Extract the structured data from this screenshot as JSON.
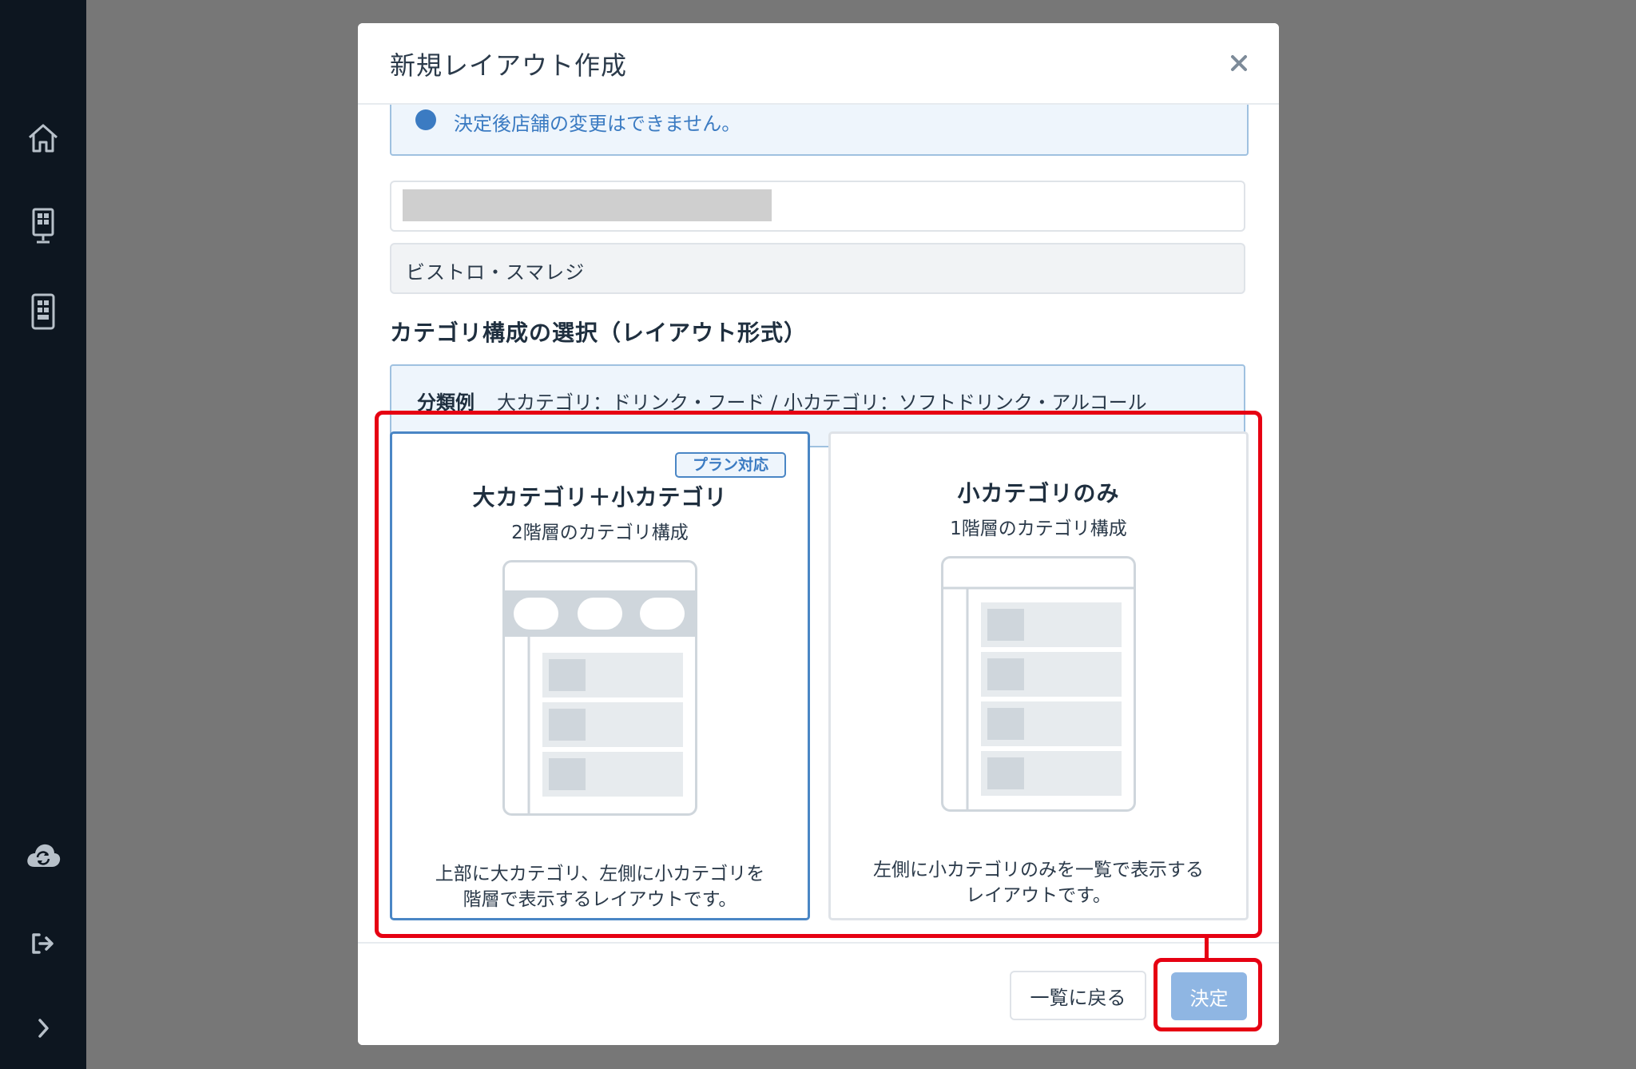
{
  "sidebar": {
    "items": [
      {
        "icon": "home-icon"
      },
      {
        "icon": "register-terminal-icon"
      },
      {
        "icon": "handheld-device-icon"
      },
      {
        "icon": "cloud-sync-icon"
      },
      {
        "icon": "logout-icon"
      },
      {
        "icon": "chevron-right-icon"
      }
    ]
  },
  "modal": {
    "title": "新規レイアウト作成",
    "close_icon": "close-icon",
    "notice_text": "決定後店舗の変更はできません。",
    "store_name": "ビストロ・スマレジ",
    "section_title": "カテゴリ構成の選択（レイアウト形式）",
    "example": {
      "label": "分類例",
      "text": "大カテゴリ：ドリンク・フード / 小カテゴリ：ソフトドリンク・アルコール"
    },
    "options": [
      {
        "badge": "プラン対応",
        "title": "大カテゴリ＋小カテゴリ",
        "subtitle": "2階層のカテゴリ構成",
        "desc_line1": "上部に大カテゴリ、左側に小カテゴリを",
        "desc_line2": "階層で表示するレイアウトです。",
        "selected": true
      },
      {
        "title": "小カテゴリのみ",
        "subtitle": "1階層のカテゴリ構成",
        "desc_line1": "左側に小カテゴリのみを一覧で表示する",
        "desc_line2": "レイアウトです。",
        "selected": false
      }
    ],
    "footer": {
      "back_label": "一覧に戻る",
      "confirm_label": "決定"
    }
  },
  "colors": {
    "sidebar_bg": "#0d1620",
    "overlay": "#777777",
    "accent": "#4a86c5",
    "confirm_disabled": "#8fb6e3",
    "highlight": "#e60012"
  }
}
